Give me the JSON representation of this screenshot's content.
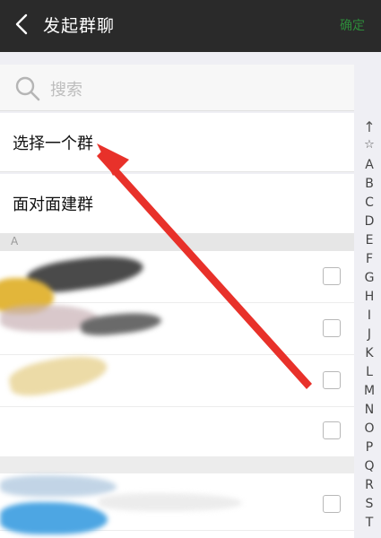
{
  "header": {
    "title": "发起群聊",
    "confirm_label": "确定"
  },
  "search": {
    "placeholder": "搜索"
  },
  "options": {
    "choose_group": "选择一个群",
    "face_to_face": "面对面建群"
  },
  "section": {
    "letter": "A"
  },
  "index_bar": {
    "up": "↑",
    "star": "☆",
    "letters": [
      "A",
      "B",
      "C",
      "D",
      "E",
      "F",
      "G",
      "H",
      "I",
      "J",
      "K",
      "L",
      "M",
      "N",
      "O",
      "P",
      "Q",
      "R",
      "S",
      "T"
    ]
  },
  "colors": {
    "topbar": "#2a2a2a",
    "confirm": "#2d8a3a",
    "arrow": "#e8312a"
  }
}
